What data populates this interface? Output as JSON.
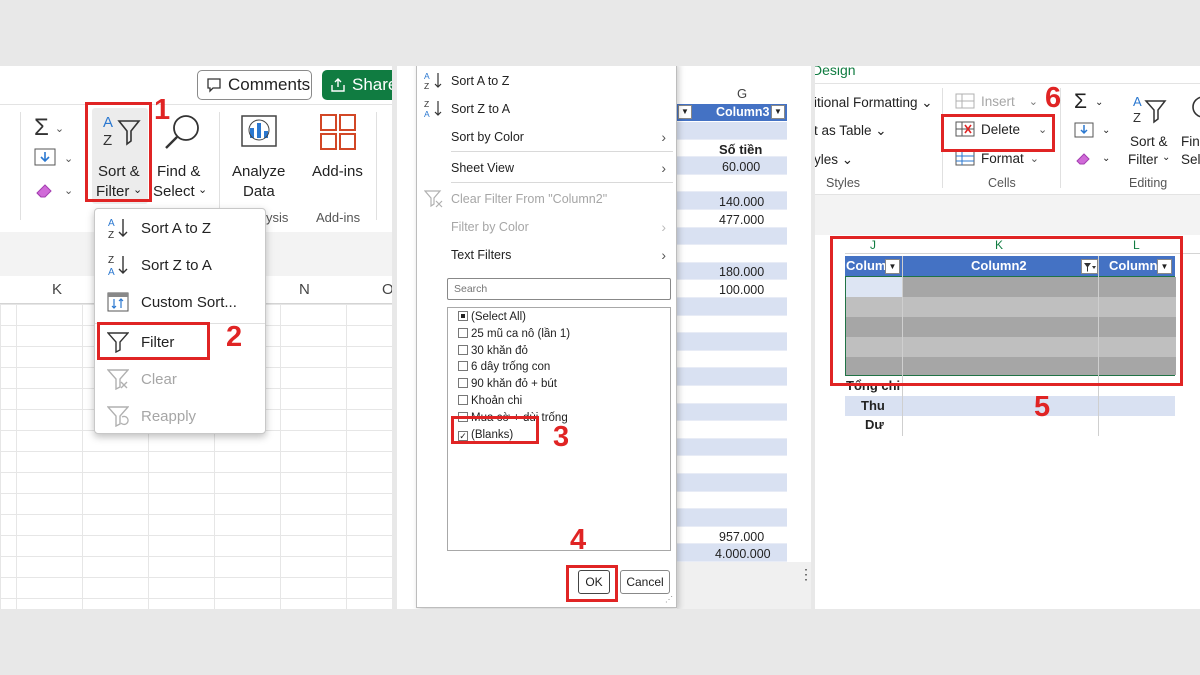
{
  "panel1": {
    "comments_label": "Comments",
    "share_label": "Share",
    "ribbon": {
      "sort_filter_line1": "Sort &",
      "sort_filter_line2": "Filter",
      "find_select_line1": "Find &",
      "find_select_line2": "Select",
      "analyze_line1": "Analyze",
      "analyze_line2": "Data",
      "addins_label": "Add-ins",
      "group_analysis_label": "ysis",
      "group_addins_label": "Add-ins"
    },
    "columns": [
      "K",
      "N",
      "O"
    ],
    "menu": {
      "sort_az": "Sort A to Z",
      "sort_za": "Sort Z to A",
      "custom_sort": "Custom Sort...",
      "filter": "Filter",
      "clear": "Clear",
      "reapply": "Reapply"
    }
  },
  "panel2": {
    "col_letter": "G",
    "col_header": "Column3",
    "values": {
      "so_tien": "Số tiền",
      "v1": "60.000",
      "v2": "140.000",
      "v3": "477.000",
      "v4": "180.000",
      "v5": "100.000",
      "v6": "957.000",
      "v7": "4.000.000"
    },
    "menu": {
      "sort_az": "Sort A to Z",
      "sort_za": "Sort Z to A",
      "sort_by_color": "Sort by Color",
      "sheet_view": "Sheet View",
      "clear_filter": "Clear Filter From \"Column2\"",
      "filter_by_color": "Filter by Color",
      "text_filters": "Text Filters",
      "search_placeholder": "Search",
      "list": [
        {
          "label": "(Select All)",
          "state": "partial"
        },
        {
          "label": "25 mũ ca nô (lần 1)",
          "state": "off"
        },
        {
          "label": "30 khăn đỏ",
          "state": "off"
        },
        {
          "label": "6 dây trống con",
          "state": "off"
        },
        {
          "label": "90 khăn đỏ + bút",
          "state": "off"
        },
        {
          "label": "Khoản chi",
          "state": "off"
        },
        {
          "label": "Mua cờ + dùi trống",
          "state": "off"
        },
        {
          "label": "(Blanks)",
          "state": "on"
        }
      ],
      "ok": "OK",
      "cancel": "Cancel"
    }
  },
  "panel3": {
    "design_tab": "Design",
    "cond_formatting": "itional Formatting",
    "format_as_table": "t as Table",
    "styles_item": "yles",
    "styles_group": "Styles",
    "insert": "Insert",
    "delete": "Delete",
    "format": "Format",
    "cells_group": "Cells",
    "sort_filter_line1": "Sort &",
    "sort_filter_line2": "Filter",
    "find_line1": "Fin",
    "find_line2": "Sele",
    "editing_group": "Editing",
    "col_letters": [
      "J",
      "K",
      "L"
    ],
    "table_headers": [
      "Colum",
      "Column2",
      "Column"
    ],
    "summary": [
      "Tổng chi",
      "Thu",
      "Dư"
    ]
  },
  "steps": [
    "1",
    "2",
    "3",
    "4",
    "5",
    "6"
  ],
  "colors": {
    "accent_red": "#e02424",
    "table_blue": "#4472c4",
    "band_blue": "#d9e1f2",
    "share_green": "#107c41",
    "selected_gray": "#a6a6a6"
  }
}
